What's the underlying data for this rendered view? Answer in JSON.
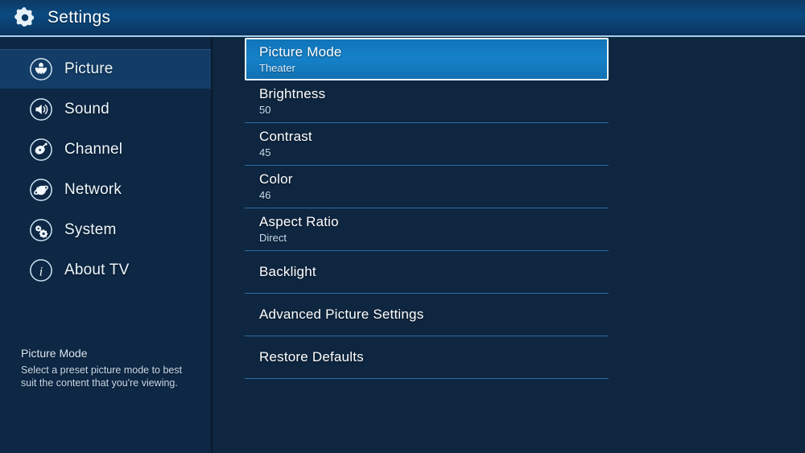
{
  "header": {
    "title": "Settings",
    "icon": "gear-icon"
  },
  "sidebar": {
    "items": [
      {
        "label": "Picture",
        "icon": "flower-icon",
        "selected": true
      },
      {
        "label": "Sound",
        "icon": "speaker-icon",
        "selected": false
      },
      {
        "label": "Channel",
        "icon": "satellite-dish-icon",
        "selected": false
      },
      {
        "label": "Network",
        "icon": "globe-icon",
        "selected": false
      },
      {
        "label": "System",
        "icon": "gears-icon",
        "selected": false
      },
      {
        "label": "About TV",
        "icon": "info-icon",
        "selected": false
      }
    ],
    "help": {
      "title": "Picture Mode",
      "body": "Select a preset picture mode to best suit the content that you're viewing."
    }
  },
  "menu": {
    "items": [
      {
        "label": "Picture Mode",
        "value": "Theater",
        "highlighted": true
      },
      {
        "label": "Brightness",
        "value": "50",
        "highlighted": false
      },
      {
        "label": "Contrast",
        "value": "45",
        "highlighted": false
      },
      {
        "label": "Color",
        "value": "46",
        "highlighted": false
      },
      {
        "label": "Aspect Ratio",
        "value": "Direct",
        "highlighted": false
      },
      {
        "label": "Backlight",
        "value": "",
        "highlighted": false
      },
      {
        "label": "Advanced Picture Settings",
        "value": "",
        "highlighted": false
      },
      {
        "label": "Restore Defaults",
        "value": "",
        "highlighted": false
      }
    ]
  },
  "colors": {
    "background": "#0e2640",
    "header_blue": "#0a4a80",
    "highlight_blue": "#1581c9",
    "divider": "#2a6ea0",
    "sidebar": "#0d2744",
    "text": "#ffffff",
    "subtext": "#c9def0"
  }
}
